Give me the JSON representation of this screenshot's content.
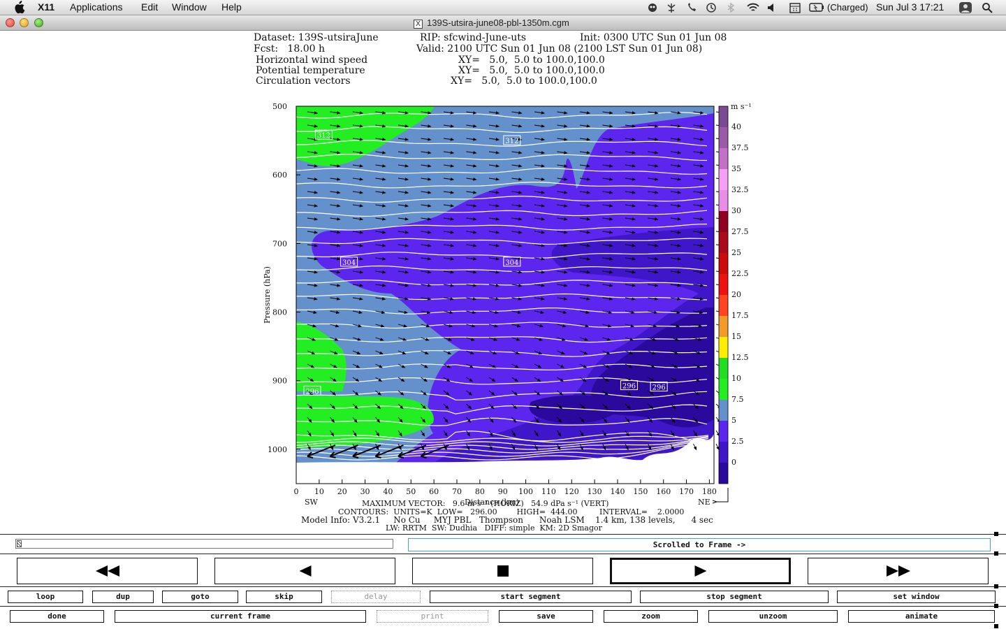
{
  "menubar": {
    "app": "X11",
    "items": [
      "Applications",
      "Edit",
      "Window",
      "Help"
    ],
    "battery": "(Charged)",
    "clock": "Sun Jul 3  17:21"
  },
  "window": {
    "title": "139S-utsira-june08-pbl-1350m.cgm"
  },
  "header": {
    "dataset": "Dataset: 139S-utsiraJune",
    "rip": "RIP: sfcwind-June-uts",
    "init": "Init: 0300 UTC Sun 01 Jun 08",
    "fcst": "Fcst:   18.00 h",
    "valid": "Valid: 2100 UTC Sun 01 Jun 08 (2100 LST Sun 01 Jun 08)",
    "fields": [
      {
        "name": "Horizontal wind speed",
        "xy": "XY=   5.0,  5.0 to 100.0,100.0"
      },
      {
        "name": "Potential temperature",
        "xy": "XY=   5.0,  5.0 to 100.0,100.0"
      },
      {
        "name": "Circulation vectors",
        "xy": "XY=   5.0,  5.0 to 100.0,100.0"
      }
    ]
  },
  "colors": {
    "c0": "#2a0a9c",
    "c2": "#3f16c8",
    "c5": "#5d26ee",
    "c75": "#6490cc",
    "c10": "#22ee22",
    "c125": "#22dd22",
    "c15": "#ffee00",
    "c175": "#f29a2a",
    "c20": "#ff4422",
    "c225": "#ee1111",
    "c25": "#cc0b0b",
    "c275": "#aa0a1a",
    "c30": "#900020",
    "c325": "#e88ee8",
    "c35": "#f5a0f5",
    "c375": "#c270c8",
    "c40": "#9a5aa8",
    "c45": "#7a4a92"
  },
  "chart_data": {
    "type": "cross-section",
    "title": "Horizontal wind speed / Potential temperature / Circulation vectors",
    "xlabel": "Distance (km)",
    "ylabel": "Pressure (hPa)",
    "x_ticks": [
      0,
      10,
      20,
      30,
      40,
      50,
      60,
      70,
      80,
      90,
      100,
      110,
      120,
      130,
      140,
      150,
      160,
      170,
      180
    ],
    "y_ticks": [
      500,
      600,
      700,
      800,
      900,
      1000
    ],
    "xlim": [
      0,
      182
    ],
    "ylim": [
      1050,
      500
    ],
    "left_endpoint": "SW",
    "right_endpoint": "NE",
    "colorbar": {
      "units": "m s⁻¹",
      "labels": [
        "0",
        "2.5",
        "5",
        "7.5",
        "10",
        "12.5",
        "15",
        "17.5",
        "20",
        "22.5",
        "25",
        "27.5",
        "30",
        "32.5",
        "35",
        "37.5",
        "40"
      ]
    },
    "contour_labels": [
      {
        "text": "312",
        "x": 12,
        "p": 542
      },
      {
        "text": "312",
        "x": 94,
        "p": 550
      },
      {
        "text": "304",
        "x": 23,
        "p": 727
      },
      {
        "text": "304",
        "x": 94,
        "p": 727
      },
      {
        "text": "296",
        "x": 7,
        "p": 915
      },
      {
        "text": "296",
        "x": 145,
        "p": 907
      },
      {
        "text": "296",
        "x": 158,
        "p": 909
      }
    ],
    "contours": {
      "units": "K",
      "low": 296.0,
      "high": 444.0,
      "interval": 2.0
    }
  },
  "footer": {
    "maxvec": "MAXIMUM VECTOR:   9.6 m s⁻¹ (HORIZ)   54.9 dPa s⁻¹ (VERT)",
    "contours": "CONTOURS:  UNITS=K  LOW=   296.00        HIGH=  444.00         INTERVAL=    2.0000",
    "model": "Model Info: V3.2.1     No Cu     MYJ PBL   Thompson      Noah LSM    1.4 km, 138 levels,      4 sec",
    "model2": "LW: RRTM  SW: Dudhia   DIFF: simple  KM: 2D Smagor"
  },
  "controls": {
    "status": "Scrolled to Frame ->",
    "row1": [
      "loop",
      "dup",
      "goto",
      "skip",
      "delay",
      "start segment",
      "stop segment",
      "set window"
    ],
    "row2": [
      "done",
      "current frame",
      "print",
      "save",
      "zoom",
      "unzoom",
      "animate"
    ],
    "disabled": [
      "delay",
      "print"
    ]
  }
}
